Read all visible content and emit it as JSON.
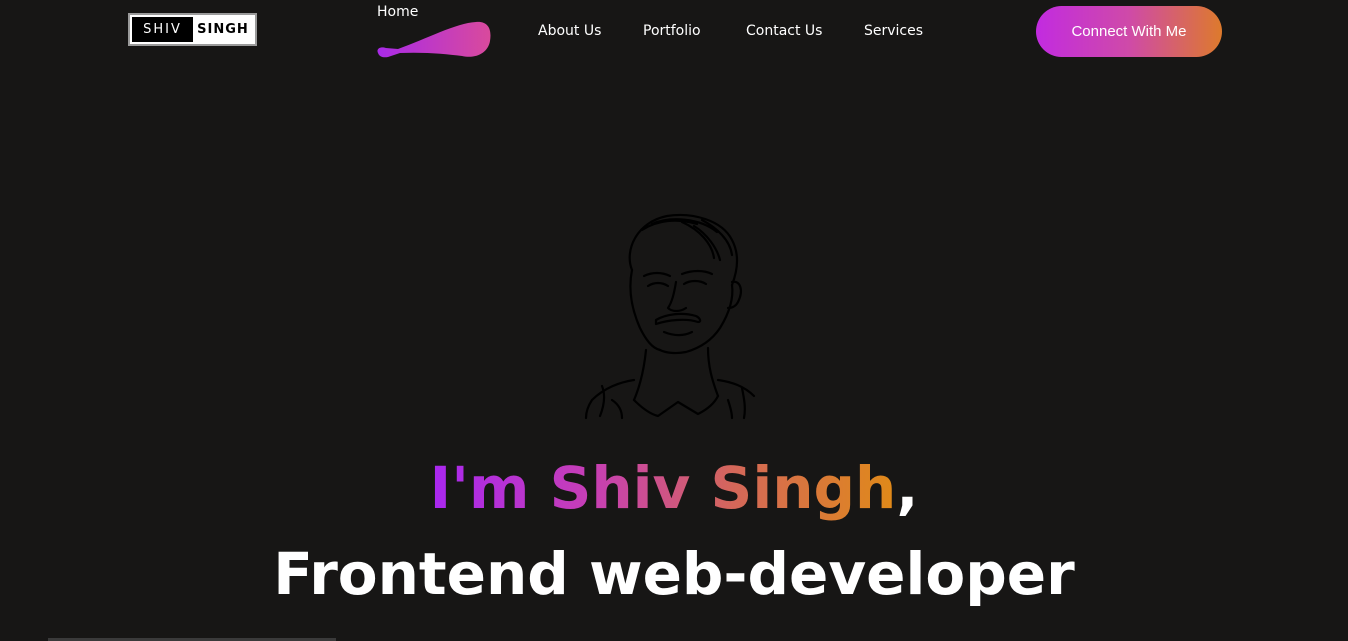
{
  "logo": {
    "left": "SHIV",
    "right": "SINGH"
  },
  "nav": {
    "home": "Home",
    "items": [
      "About Us",
      "Portfolio",
      "Contact Us",
      "Services"
    ]
  },
  "cta": {
    "label": "Connect With Me"
  },
  "hero": {
    "name_line": "I'm Shiv Singh",
    "comma": ",",
    "subtitle": "Frontend web-developer"
  },
  "colors": {
    "background": "#171615",
    "gradient_start": "#a927f0",
    "gradient_mid": "#c73fb4",
    "gradient_end": "#e08a18"
  },
  "icons": [
    "home-active-indicator",
    "portrait-line-art"
  ]
}
